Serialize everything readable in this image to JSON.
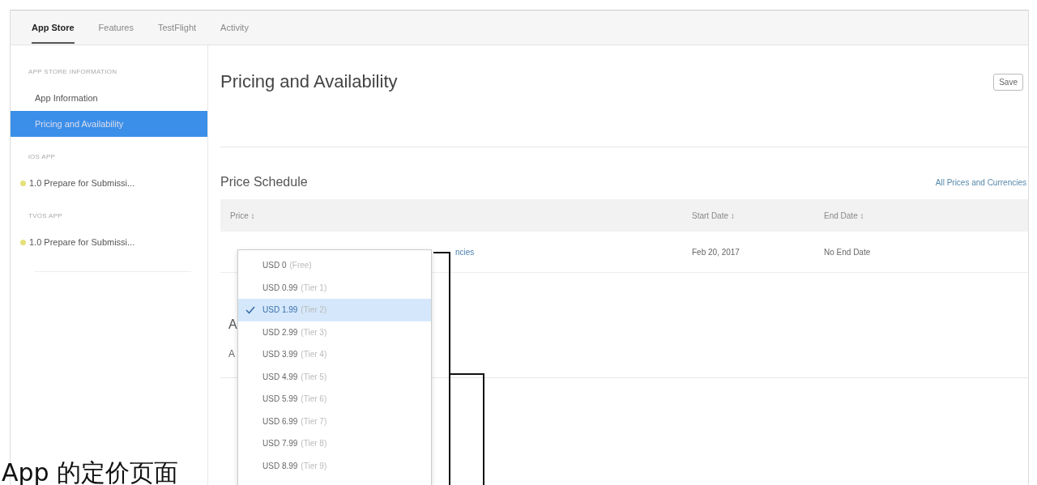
{
  "tabs": [
    {
      "label": "App Store",
      "selected": true
    },
    {
      "label": "Features",
      "selected": false
    },
    {
      "label": "TestFlight",
      "selected": false
    },
    {
      "label": "Activity",
      "selected": false
    }
  ],
  "sidebar": {
    "sections": [
      {
        "header": "APP STORE INFORMATION",
        "items": [
          {
            "label": "App Information",
            "selected": false,
            "kind": "plain"
          },
          {
            "label": "Pricing and Availability",
            "selected": true,
            "kind": "plain"
          }
        ]
      },
      {
        "header": "iOS APP",
        "items": [
          {
            "label": "1.0 Prepare for Submissi...",
            "selected": false,
            "kind": "status"
          }
        ]
      },
      {
        "header": "TVOS APP",
        "items": [
          {
            "label": "1.0 Prepare for Submissi...",
            "selected": false,
            "kind": "status"
          }
        ]
      }
    ]
  },
  "page": {
    "title": "Pricing and Availability",
    "save_button": "Save"
  },
  "price_schedule": {
    "title": "Price Schedule",
    "link": "All Prices and Currencies",
    "columns": [
      "Price",
      "Start Date",
      "End Date"
    ],
    "sort_icon": "↕",
    "rows": [
      {
        "price": "ncies",
        "start_date": "Feb 20, 2017",
        "end_date": "No End Date"
      }
    ]
  },
  "next_section": {
    "title": "A",
    "subtitle": "A"
  },
  "price_dropdown": {
    "options": [
      {
        "price": "USD 0",
        "tier": "(Free)",
        "selected": false
      },
      {
        "price": "USD 0.99",
        "tier": "(Tier 1)",
        "selected": false
      },
      {
        "price": "USD 1.99",
        "tier": "(Tier 2)",
        "selected": true
      },
      {
        "price": "USD 2.99",
        "tier": "(Tier 3)",
        "selected": false
      },
      {
        "price": "USD 3.99",
        "tier": "(Tier 4)",
        "selected": false
      },
      {
        "price": "USD 4.99",
        "tier": "(Tier 5)",
        "selected": false
      },
      {
        "price": "USD 5.99",
        "tier": "(Tier 6)",
        "selected": false
      },
      {
        "price": "USD 6.99",
        "tier": "(Tier 7)",
        "selected": false
      },
      {
        "price": "USD 7.99",
        "tier": "(Tier 8)",
        "selected": false
      },
      {
        "price": "USD 8.99",
        "tier": "(Tier 9)",
        "selected": false
      }
    ]
  },
  "caption": "App 的定价页面"
}
